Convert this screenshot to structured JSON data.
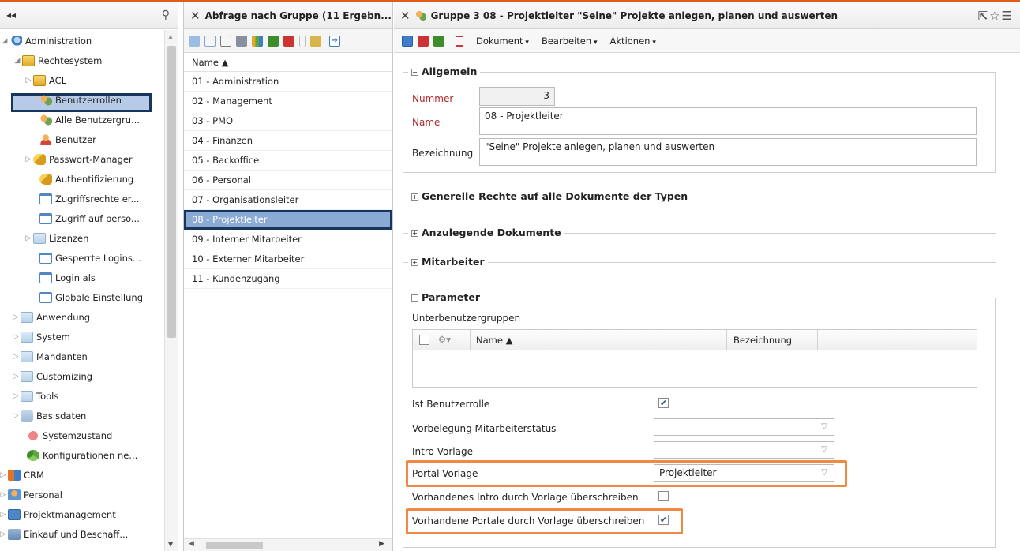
{
  "left_panel": {
    "collapse_label": "◂◂",
    "tree": [
      {
        "label": "Administration",
        "icon": "admin-gear-icon"
      },
      {
        "label": "Rechtesystem",
        "icon": "lock-folder-icon"
      },
      {
        "label": "ACL",
        "icon": "lock-icon"
      },
      {
        "label": "Benutzerrollen",
        "icon": "user-roles-icon"
      },
      {
        "label": "Alle Benutzergru...",
        "icon": "user-groups-icon"
      },
      {
        "label": "Benutzer",
        "icon": "user-icon"
      },
      {
        "label": "Passwort-Manager",
        "icon": "key-icon"
      },
      {
        "label": "Authentifizierung",
        "icon": "key-icon"
      },
      {
        "label": "Zugriffsrechte er...",
        "icon": "window-icon"
      },
      {
        "label": "Zugriff auf perso...",
        "icon": "window-icon"
      },
      {
        "label": "Lizenzen",
        "icon": "folder-icon"
      },
      {
        "label": "Gesperrte Logins...",
        "icon": "window-icon"
      },
      {
        "label": "Login als",
        "icon": "window-icon"
      },
      {
        "label": "Globale Einstellung",
        "icon": "window-icon"
      },
      {
        "label": "Anwendung",
        "icon": "folder-icon"
      },
      {
        "label": "System",
        "icon": "folder-icon"
      },
      {
        "label": "Mandanten",
        "icon": "folder-icon"
      },
      {
        "label": "Customizing",
        "icon": "folder-icon"
      },
      {
        "label": "Tools",
        "icon": "folder-icon"
      },
      {
        "label": "Basisdaten",
        "icon": "basisdaten-icon"
      },
      {
        "label": "Systemzustand",
        "icon": "heart-icon"
      },
      {
        "label": "Konfigurationen ne...",
        "icon": "recycle-icon"
      },
      {
        "label": "CRM",
        "icon": "crm-icon"
      },
      {
        "label": "Personal",
        "icon": "person-icon"
      },
      {
        "label": "Projektmanagement",
        "icon": "project-icon"
      },
      {
        "label": "Einkauf und Beschaff...",
        "icon": "cart-icon"
      }
    ]
  },
  "middle_panel": {
    "title": "Abfrage nach Gruppe (11 Ergebn...",
    "column_header": "Name ▲",
    "rows": [
      "01 - Administration",
      "02 - Management",
      "03 - PMO",
      "04 - Finanzen",
      "05 - Backoffice",
      "06 - Personal",
      "07 - Organisationsleiter",
      "08 - Projektleiter",
      "09 - Interner Mitarbeiter",
      "10 - Externer Mitarbeiter",
      "11 - Kundenzugang"
    ],
    "selected_row": "08 - Projektleiter"
  },
  "right_panel": {
    "title": "Gruppe 3 08 - Projektleiter \"Seine\" Projekte anlegen, planen und auswerten",
    "menus": {
      "dokument": "Dokument",
      "bearbeiten": "Bearbeiten",
      "aktionen": "Aktionen"
    },
    "allgemein": {
      "legend": "Allgemein",
      "nummer_label": "Nummer",
      "nummer_value": "3",
      "name_label": "Name",
      "name_value": "08 - Projektleiter",
      "bezeichnung_label": "Bezeichnung",
      "bezeichnung_value": "\"Seine\" Projekte anlegen, planen und auswerten"
    },
    "sections": {
      "generelle_rechte": "Generelle Rechte auf alle Dokumente der Typen",
      "anzulegende": "Anzulegende Dokumente",
      "mitarbeiter": "Mitarbeiter"
    },
    "parameter": {
      "legend": "Parameter",
      "unterbenutzergruppen": "Unterbenutzergruppen",
      "grid_name_header": "Name ▲",
      "grid_bezeichnung_header": "Bezeichnung",
      "ist_benutzerrolle_label": "Ist Benutzerrolle",
      "ist_benutzerrolle_checked": true,
      "vorbelegung_label": "Vorbelegung Mitarbeiterstatus",
      "vorbelegung_value": "",
      "intro_vorlage_label": "Intro-Vorlage",
      "intro_vorlage_value": "",
      "portal_vorlage_label": "Portal-Vorlage",
      "portal_vorlage_value": "Projektleiter",
      "intro_ueberschreiben_label": "Vorhandenes Intro durch Vorlage überschreiben",
      "intro_ueberschreiben_checked": false,
      "portale_ueberschreiben_label": "Vorhandene Portale durch Vorlage überschreiben",
      "portale_ueberschreiben_checked": true
    }
  },
  "colors": {
    "accent_orange": "#ef8a46",
    "selection_dark": "#16365e",
    "selection_fill": "#8aa9d3",
    "required_label": "#b02525"
  }
}
